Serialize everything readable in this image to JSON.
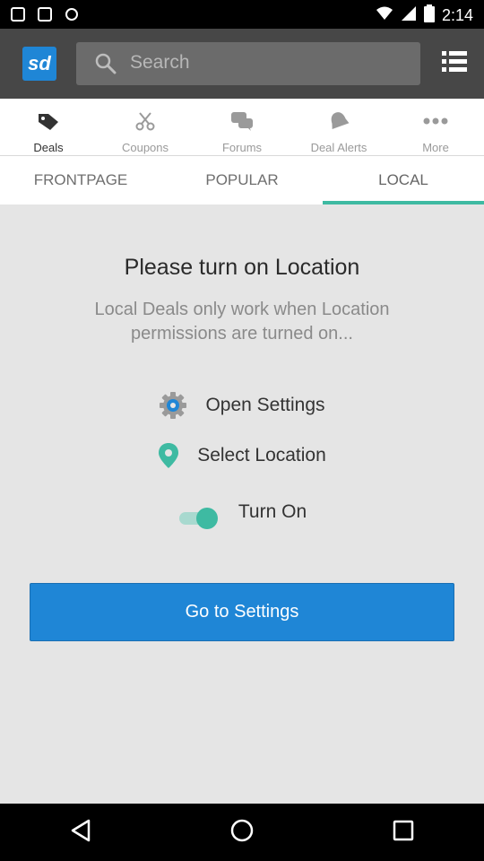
{
  "status_bar": {
    "time": "2:14"
  },
  "app_bar": {
    "logo_text": "sd",
    "search": {
      "placeholder": "Search",
      "value": ""
    }
  },
  "tabs": [
    {
      "label": "Deals",
      "icon": "tag-icon",
      "active": true
    },
    {
      "label": "Coupons",
      "icon": "scissors-icon",
      "active": false
    },
    {
      "label": "Forums",
      "icon": "chat-icon",
      "active": false
    },
    {
      "label": "Deal Alerts",
      "icon": "bell-icon",
      "active": false
    },
    {
      "label": "More",
      "icon": "more-dots-icon",
      "active": false
    }
  ],
  "subtabs": [
    {
      "label": "FRONTPAGE",
      "active": false
    },
    {
      "label": "POPULAR",
      "active": false
    },
    {
      "label": "LOCAL",
      "active": true
    }
  ],
  "content": {
    "title": "Please turn on Location",
    "subtitle": "Local Deals only work when Location permissions are turned on...",
    "steps": [
      {
        "label": "Open Settings",
        "icon": "gear-icon"
      },
      {
        "label": "Select Location",
        "icon": "map-pin-icon"
      },
      {
        "label": "Turn On",
        "icon": "toggle-icon"
      }
    ],
    "button_label": "Go to Settings"
  },
  "colors": {
    "accent": "#1f86d6",
    "teal": "#3ebaa2",
    "app_bar": "#474747"
  }
}
